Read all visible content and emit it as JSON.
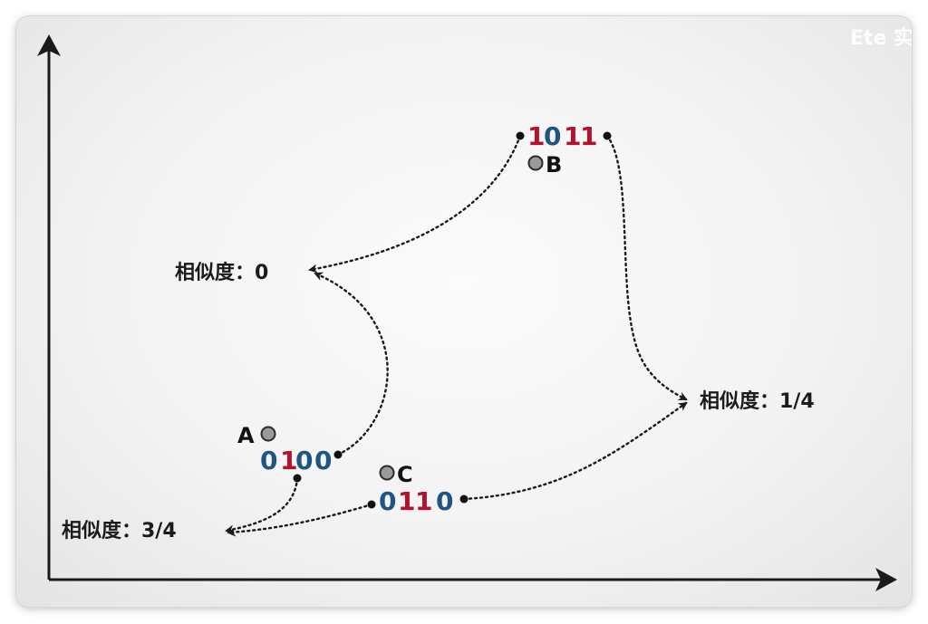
{
  "watermark": "Ete 实录",
  "points": {
    "A": {
      "label": "A",
      "code": [
        "0",
        "1",
        "0",
        "0"
      ]
    },
    "B": {
      "label": "B",
      "code": [
        "1",
        "0",
        "1",
        "1"
      ]
    },
    "C": {
      "label": "C",
      "code": [
        "0",
        "1",
        "1",
        "0"
      ]
    }
  },
  "similarities": {
    "ab": "相似度：0",
    "bc": "相似度：1/4",
    "ac": "相似度：3/4"
  },
  "colors": {
    "bit_zero": "#1f5583",
    "bit_one": "#b3122e",
    "point": "#9a9a9a"
  }
}
